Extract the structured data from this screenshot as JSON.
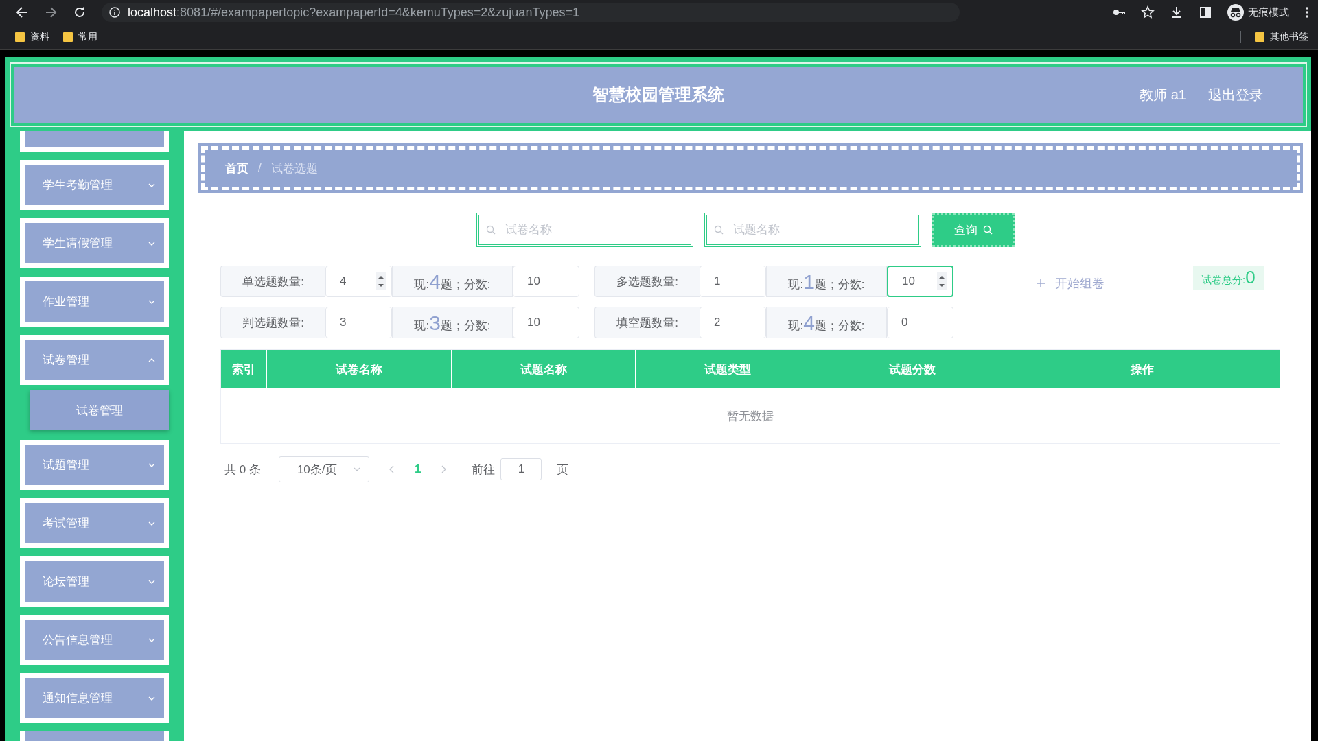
{
  "browser": {
    "url_host": "localhost",
    "url_rest": ":8081/#/exampapertopic?exampaperId=4&kemuTypes=2&zujuanTypes=1",
    "profile": "无痕模式"
  },
  "bookmarks": {
    "left": [
      "资料",
      "常用"
    ],
    "right": "其他书签"
  },
  "header": {
    "title": "智慧校园管理系统",
    "user": "教师 a1",
    "logout": "退出登录"
  },
  "sidebar": {
    "items": [
      {
        "kind": "clipped"
      },
      {
        "kind": "menu",
        "label": "学生考勤管理",
        "expanded": false
      },
      {
        "kind": "menu",
        "label": "学生请假管理",
        "expanded": false
      },
      {
        "kind": "menu",
        "label": "作业管理",
        "expanded": false
      },
      {
        "kind": "menu",
        "label": "试卷管理",
        "expanded": true,
        "children": [
          {
            "label": "试卷管理",
            "selected": true
          }
        ]
      },
      {
        "kind": "menu",
        "label": "试题管理",
        "expanded": false
      },
      {
        "kind": "menu",
        "label": "考试管理",
        "expanded": false
      },
      {
        "kind": "menu",
        "label": "论坛管理",
        "expanded": false
      },
      {
        "kind": "menu",
        "label": "公告信息管理",
        "expanded": false
      },
      {
        "kind": "menu",
        "label": "通知信息管理",
        "expanded": false
      },
      {
        "kind": "clipped"
      }
    ]
  },
  "breadcrumb": {
    "items": [
      "首页",
      "试卷选题"
    ],
    "separator": "/"
  },
  "search": {
    "fields": [
      {
        "placeholder": "试卷名称"
      },
      {
        "placeholder": "试题名称"
      }
    ],
    "button": "查询"
  },
  "counts": [
    [
      {
        "label": "单选题数量:",
        "value": "4",
        "spinner": true,
        "focused": false,
        "now_prefix": "现:",
        "now": "4",
        "now_suffix": "题；分数:",
        "score": "10",
        "score_spinner": false,
        "score_focused": false
      },
      {
        "label": "多选题数量:",
        "value": "1",
        "spinner": false,
        "focused": false,
        "now_prefix": "现:",
        "now": "1",
        "now_suffix": "题；分数:",
        "score": "10",
        "score_spinner": true,
        "score_focused": true
      }
    ],
    [
      {
        "label": "判选题数量:",
        "value": "3",
        "spinner": false,
        "focused": false,
        "now_prefix": "现:",
        "now": "3",
        "now_suffix": "题；分数:",
        "score": "10",
        "score_spinner": false,
        "score_focused": false
      },
      {
        "label": "填空题数量:",
        "value": "2",
        "spinner": false,
        "focused": false,
        "now_prefix": "现:",
        "now": "4",
        "now_suffix": "题；分数:",
        "score": "0",
        "score_spinner": false,
        "score_focused": false
      }
    ]
  ],
  "compose_button": "开始组卷",
  "total": {
    "label": "试卷总分:",
    "value": "0"
  },
  "table": {
    "columns": [
      "索引",
      "试卷名称",
      "试题名称",
      "试题类型",
      "试题分数",
      "操作"
    ],
    "empty_text": "暂无数据"
  },
  "pagination": {
    "total": "共 0 条",
    "page_size": "10条/页",
    "pages": [
      {
        "label": "1",
        "selected": true
      }
    ],
    "goto_label": "前往",
    "goto_value": "1",
    "goto_suffix": "页"
  }
}
